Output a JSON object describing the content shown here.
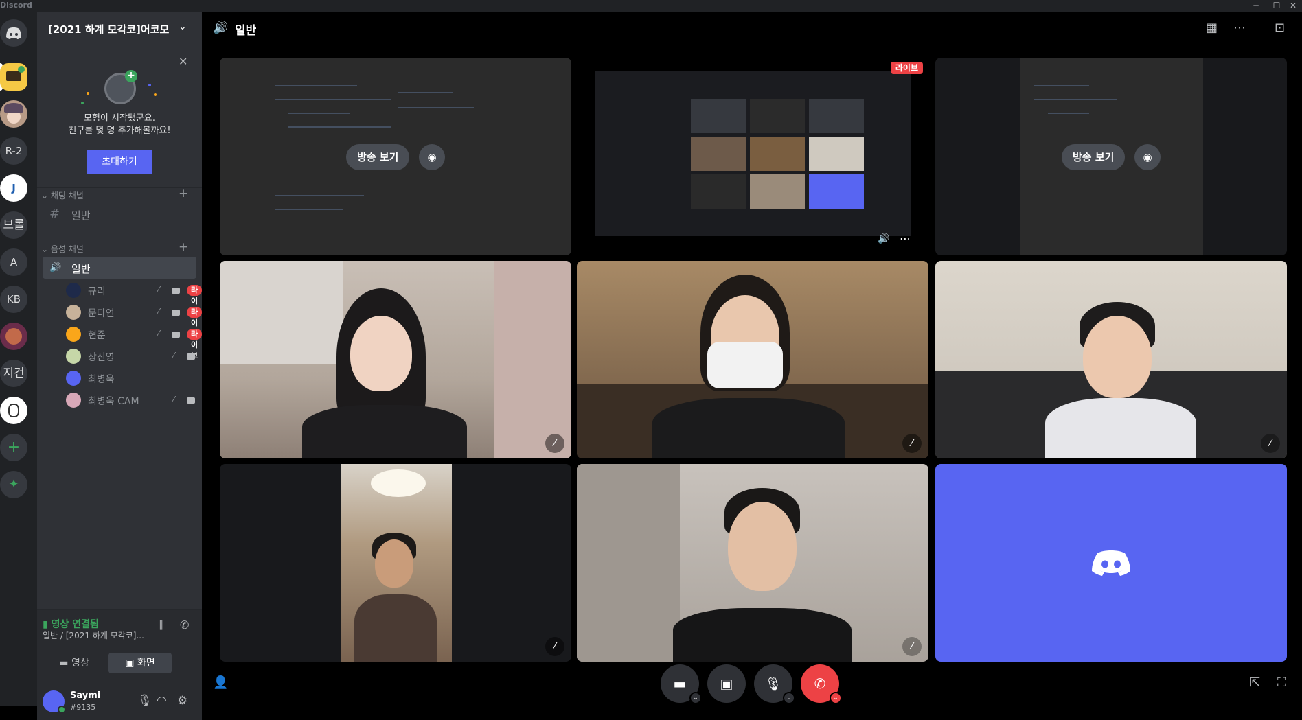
{
  "app": {
    "brand": "Discord",
    "win_controls": [
      "─",
      "☐",
      "✕"
    ]
  },
  "rail": {
    "servers": [
      {
        "label": "",
        "name": "home"
      },
      {
        "label": "",
        "name": "server-laptop"
      },
      {
        "label": "",
        "name": "server-anime"
      },
      {
        "label": "R-2",
        "name": "server-r2"
      },
      {
        "label": "J",
        "name": "server-j"
      },
      {
        "label": "브롤",
        "name": "server-brawl"
      },
      {
        "label": "A",
        "name": "server-a"
      },
      {
        "label": "KB",
        "name": "server-kb"
      },
      {
        "label": "",
        "name": "server-art"
      },
      {
        "label": "지건",
        "name": "server-jigeon"
      },
      {
        "label": "",
        "name": "server-sketch"
      },
      {
        "label": "+",
        "name": "add-server"
      },
      {
        "label": "✦",
        "name": "explore"
      }
    ]
  },
  "guild": {
    "name": "[2021 하계 모각코]어코모",
    "chevron": "⌄"
  },
  "invite": {
    "line1": "모험이 시작됐군요.",
    "line2": "친구를 몇 명 추가해볼까요!",
    "button": "초대하기",
    "close": "✕"
  },
  "categories": {
    "text": "채팅 채널",
    "voice": "음성 채널"
  },
  "text_channel": {
    "name": "일반",
    "icon": "#"
  },
  "voice_channel": {
    "name": "일반",
    "icon": "🔊"
  },
  "voice_users": [
    {
      "name": "규리",
      "live": "라이브",
      "muted": true,
      "cam": true,
      "color": "#1e2a4a"
    },
    {
      "name": "문다연",
      "live": "라이브",
      "muted": true,
      "cam": true,
      "color": "#c7b29a"
    },
    {
      "name": "현준",
      "live": "라이브",
      "muted": true,
      "cam": true,
      "color": "#faa61a"
    },
    {
      "name": "장진영",
      "live": "",
      "muted": true,
      "cam": true,
      "color": "#c6d7a8"
    },
    {
      "name": "최병욱",
      "live": "",
      "muted": false,
      "cam": false,
      "color": "#5865f2"
    },
    {
      "name": "최병욱 CAM",
      "live": "",
      "muted": true,
      "cam": true,
      "color": "#d8a8b8"
    }
  ],
  "rtc": {
    "status": "영상 연결됨",
    "sub": "일반 / [2021 하계 모각코]...",
    "video_label": "영상",
    "screen_label": "화면"
  },
  "user": {
    "name": "Saymi",
    "tag": "#9135"
  },
  "main": {
    "channel_title": "일반",
    "stream_btn": "방송 보기",
    "live_badge": "라이브"
  },
  "colors": {
    "accent": "#5865f2",
    "live": "#ed4245",
    "connected": "#3ba55d"
  }
}
